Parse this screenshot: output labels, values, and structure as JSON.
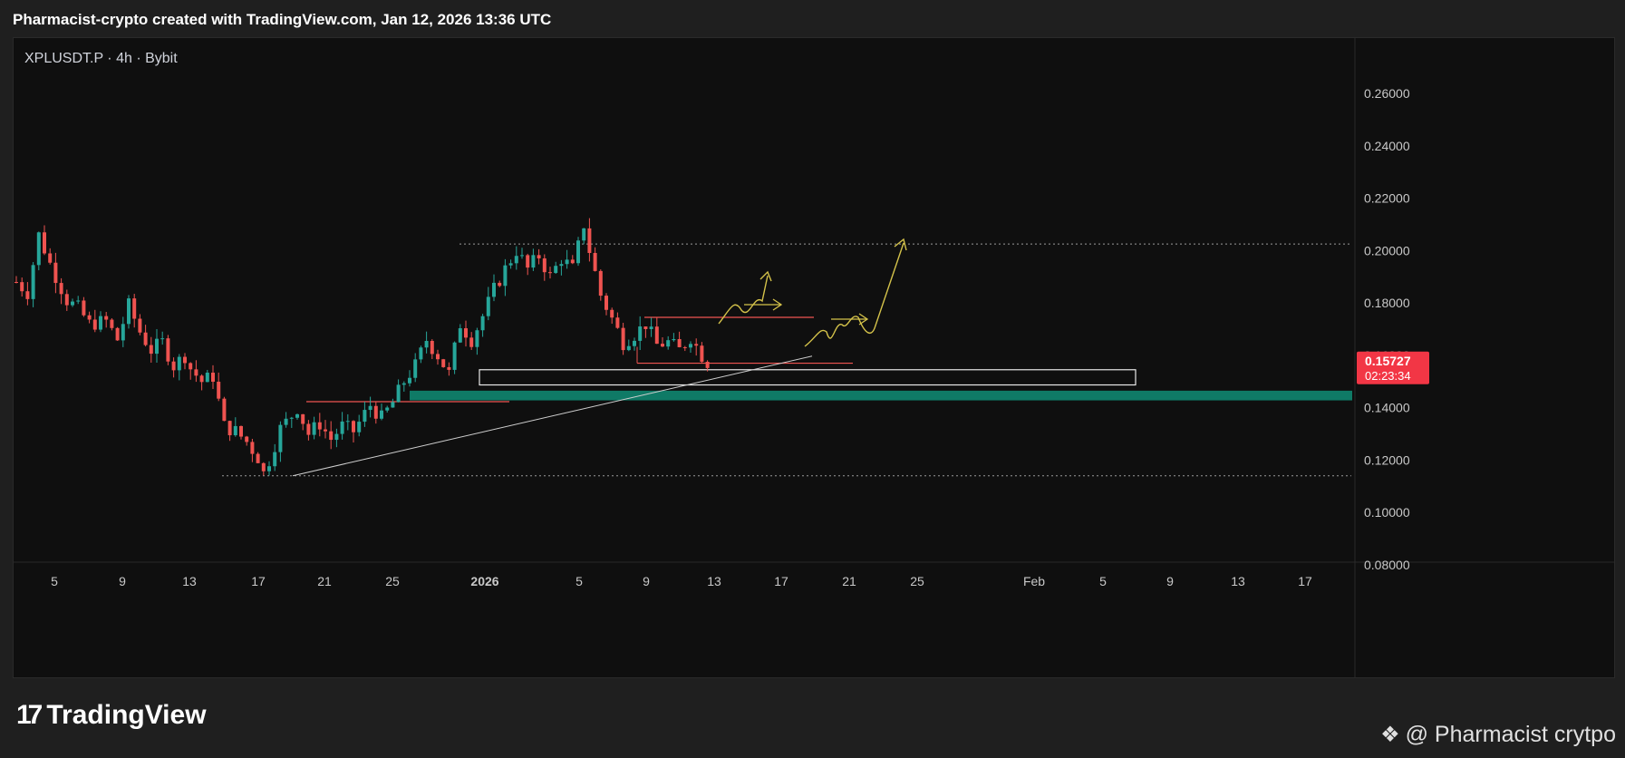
{
  "header": {
    "title": "Pharmacist-crypto created with TradingView.com, Jan 12, 2026 13:36 UTC"
  },
  "symbol": {
    "label": "XPLUSDT.P · 4h · Bybit"
  },
  "price_tag": {
    "price": "0.15727",
    "countdown": "02:23:34"
  },
  "footer": {
    "logo_text": "TradingView",
    "logo_mark": "17",
    "watermark": "@ Pharmacist crytpo"
  },
  "colors": {
    "up": "#26a69a",
    "down": "#ef5350",
    "zone": "#0f7a66",
    "path": "#d4c24a",
    "price_tag": "#f23645"
  },
  "chart_data": {
    "type": "candlestick",
    "ylim": [
      0.06,
      0.265
    ],
    "y_ticks": [
      "0.26000",
      "0.24000",
      "0.22000",
      "0.20000",
      "0.18000",
      "0.16000",
      "0.14000",
      "0.12000",
      "0.10000",
      "0.08000"
    ],
    "x_ticks": [
      "5",
      "9",
      "13",
      "17",
      "21",
      "25",
      "2026",
      "5",
      "9",
      "13",
      "17",
      "21",
      "25",
      "Feb",
      "5",
      "9",
      "13",
      "17"
    ],
    "price_path": [
      [
        0,
        0.188
      ],
      [
        2,
        0.184
      ],
      [
        4,
        0.206
      ],
      [
        6,
        0.195
      ],
      [
        9,
        0.181
      ],
      [
        11,
        0.178
      ],
      [
        13,
        0.172
      ],
      [
        16,
        0.173
      ],
      [
        18,
        0.166
      ],
      [
        20,
        0.179
      ],
      [
        22,
        0.169
      ],
      [
        24,
        0.162
      ],
      [
        26,
        0.165
      ],
      [
        28,
        0.156
      ],
      [
        30,
        0.16
      ],
      [
        31,
        0.155
      ],
      [
        33,
        0.15
      ],
      [
        35,
        0.152
      ],
      [
        37,
        0.133
      ],
      [
        39,
        0.131
      ],
      [
        41,
        0.127
      ],
      [
        43,
        0.121
      ],
      [
        44,
        0.115
      ],
      [
        45,
        0.12
      ],
      [
        47,
        0.132
      ],
      [
        49,
        0.137
      ],
      [
        50,
        0.14
      ],
      [
        52,
        0.13
      ],
      [
        54,
        0.134
      ],
      [
        56,
        0.128
      ],
      [
        58,
        0.133
      ],
      [
        60,
        0.131
      ],
      [
        63,
        0.141
      ],
      [
        65,
        0.136
      ],
      [
        67,
        0.142
      ],
      [
        69,
        0.15
      ],
      [
        71,
        0.156
      ],
      [
        73,
        0.166
      ],
      [
        75,
        0.16
      ],
      [
        77,
        0.153
      ],
      [
        79,
        0.172
      ],
      [
        81,
        0.166
      ],
      [
        83,
        0.175
      ],
      [
        85,
        0.185
      ],
      [
        87,
        0.193
      ],
      [
        89,
        0.2
      ],
      [
        91,
        0.193
      ],
      [
        93,
        0.198
      ],
      [
        95,
        0.19
      ],
      [
        97,
        0.197
      ],
      [
        99,
        0.193
      ],
      [
        101,
        0.21
      ],
      [
        102,
        0.2
      ],
      [
        104,
        0.183
      ],
      [
        106,
        0.174
      ],
      [
        108,
        0.165
      ],
      [
        110,
        0.168
      ],
      [
        112,
        0.172
      ],
      [
        114,
        0.164
      ],
      [
        116,
        0.165
      ],
      [
        118,
        0.162
      ],
      [
        120,
        0.167
      ],
      [
        122,
        0.16
      ],
      [
        123,
        0.1573
      ]
    ],
    "annotations": {
      "resistance_dotted": 0.2025,
      "support_dotted": 0.114,
      "range_high": 0.1745,
      "range_low": 0.157,
      "support_zone": [
        0.1428,
        0.1465
      ],
      "white_box": [
        0.1487,
        0.1545
      ],
      "old_resistance": 0.1423
    }
  }
}
